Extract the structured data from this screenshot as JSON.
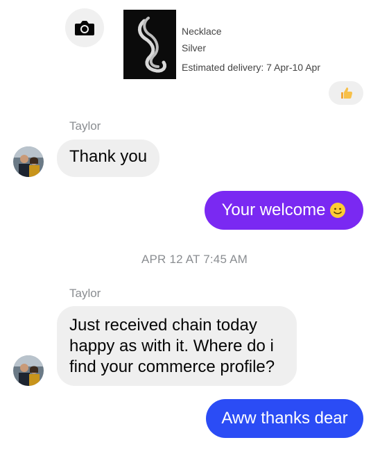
{
  "product": {
    "name": "Necklace",
    "variant": "Silver",
    "delivery": "Estimated delivery: 7 Apr-10 Apr"
  },
  "icons": {
    "camera": "camera-icon",
    "reaction": "thumbs-up-icon",
    "emoji": "smiling-face-emoji"
  },
  "colors": {
    "outgoing_purple": "#7a29f2",
    "outgoing_blue": "#2b4cf5",
    "incoming_bg": "#efefef",
    "meta_text": "#8a8d91"
  },
  "messages": [
    {
      "sender": "Taylor",
      "text": "Thank you"
    },
    {
      "text": "Your welcome"
    },
    {
      "sender": "Taylor",
      "text": "Just received chain today happy as with it. Where do i find your commerce profile?"
    },
    {
      "text": "Aww thanks dear"
    }
  ],
  "timestamp": "APR 12 AT 7:45 AM"
}
